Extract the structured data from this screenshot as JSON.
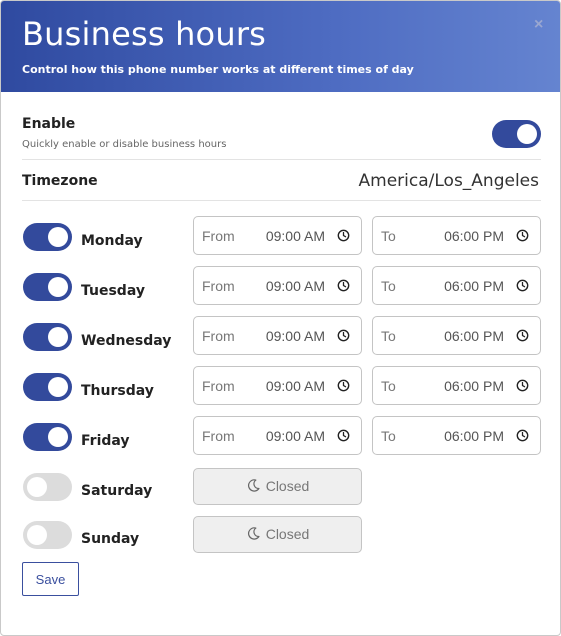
{
  "dialog": {
    "title": "Business hours",
    "subtitle": "Control how this phone number works at different times of day",
    "close_label": "×"
  },
  "enable": {
    "label": "Enable",
    "hint": "Quickly enable or disable business hours",
    "on": true
  },
  "timezone": {
    "label": "Timezone",
    "value": "America/Los_Angeles"
  },
  "days": [
    {
      "name": "Monday",
      "on": true,
      "from_prefix": "From",
      "from": "09:00 AM",
      "to_prefix": "To",
      "to": "06:00 PM"
    },
    {
      "name": "Tuesday",
      "on": true,
      "from_prefix": "From",
      "from": "09:00 AM",
      "to_prefix": "To",
      "to": "06:00 PM"
    },
    {
      "name": "Wednesday",
      "on": true,
      "from_prefix": "From",
      "from": "09:00 AM",
      "to_prefix": "To",
      "to": "06:00 PM"
    },
    {
      "name": "Thursday",
      "on": true,
      "from_prefix": "From",
      "from": "09:00 AM",
      "to_prefix": "To",
      "to": "06:00 PM"
    },
    {
      "name": "Friday",
      "on": true,
      "from_prefix": "From",
      "from": "09:00 AM",
      "to_prefix": "To",
      "to": "06:00 PM"
    },
    {
      "name": "Saturday",
      "on": false,
      "closed_label": "Closed"
    },
    {
      "name": "Sunday",
      "on": false,
      "closed_label": "Closed"
    }
  ],
  "actions": {
    "save_label": "Save"
  },
  "colors": {
    "accent": "#334a9c",
    "toggle_off": "#dcdcdc",
    "header_start": "#2f4aa0",
    "header_end": "#6584d0"
  },
  "icons": {
    "close": "close-icon",
    "time": "clock-icon",
    "closed": "moon-icon"
  }
}
